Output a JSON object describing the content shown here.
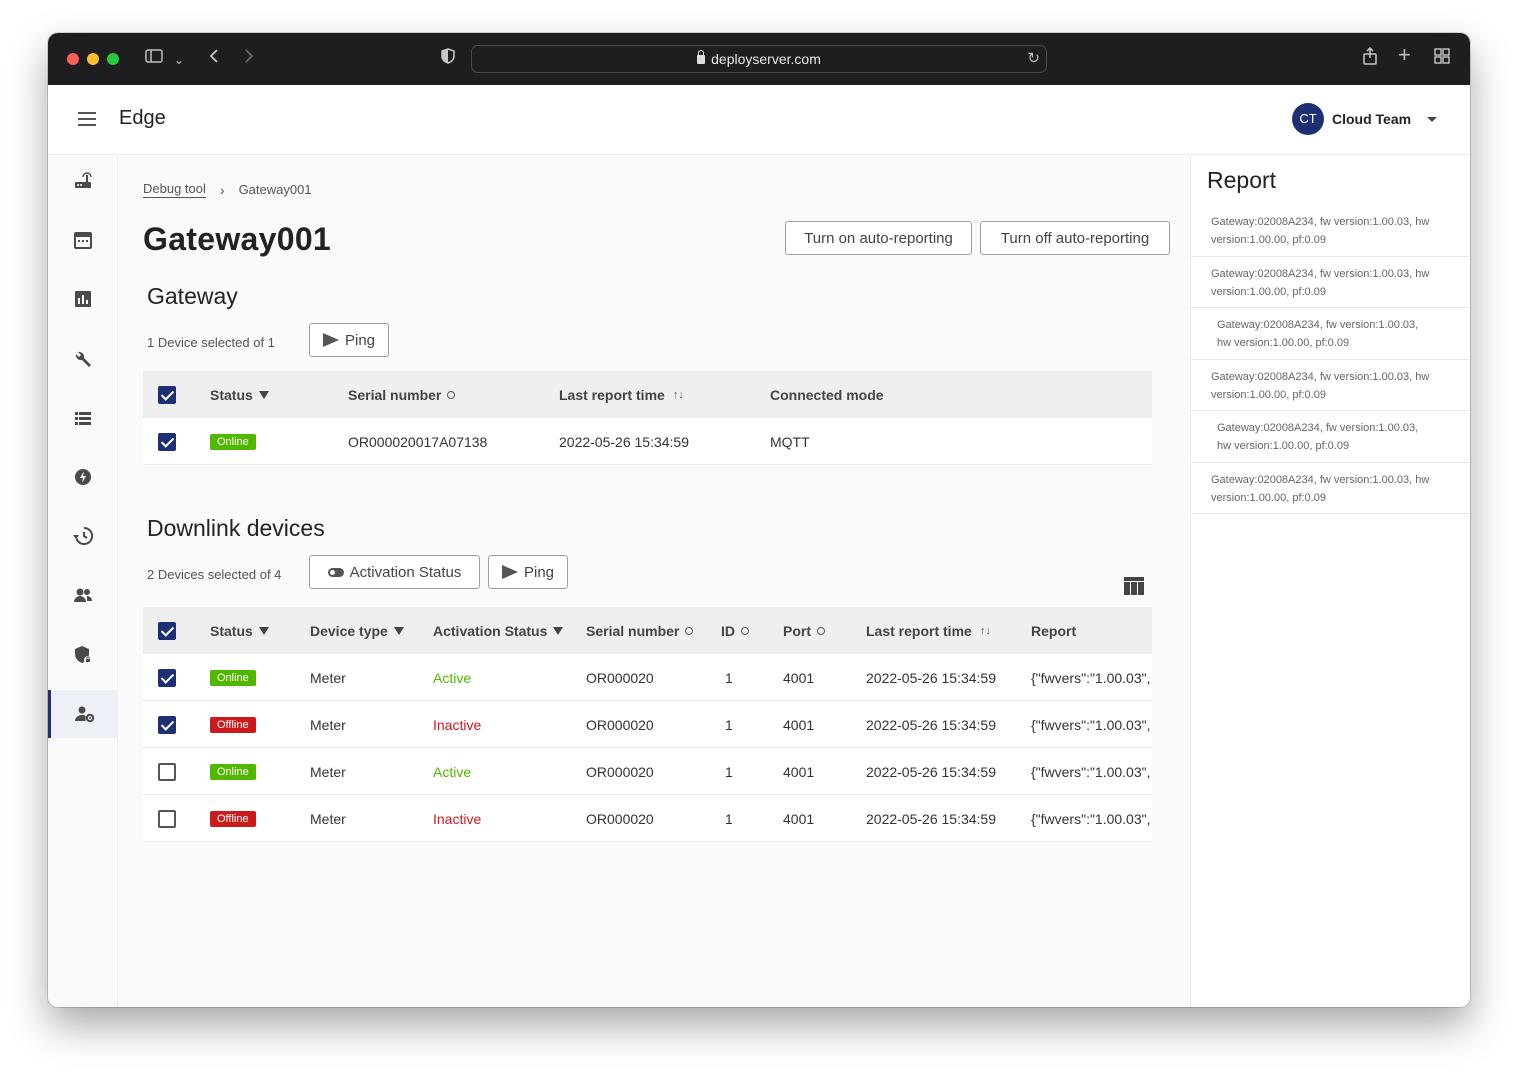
{
  "browser": {
    "url": "deployserver.com"
  },
  "app": {
    "title": "Edge",
    "user": {
      "initials": "CT",
      "name": "Cloud Team"
    }
  },
  "nav": {
    "items": [
      "router-icon",
      "calendar-icon",
      "bar-chart-icon",
      "wrench-icon",
      "list-icon",
      "eco-icon",
      "history-icon",
      "group-icon",
      "shield-lock-icon",
      "user-settings-icon"
    ],
    "active": "user-settings-icon"
  },
  "breadcrumb": {
    "link": "Debug tool",
    "current": "Gateway001"
  },
  "page": {
    "title": "Gateway001",
    "btn_auto_on": "Turn on auto-reporting",
    "btn_auto_off": "Turn off auto-reporting"
  },
  "gateway": {
    "title": "Gateway",
    "selection": "1 Device selected of 1",
    "ping_label": "Ping",
    "headers": {
      "status": "Status",
      "serial": "Serial number",
      "last_report": "Last report time",
      "mode": "Connected mode"
    },
    "rows": [
      {
        "checked": true,
        "status": "Online",
        "serial": "OR000020017A07138",
        "last_report": "2022-05-26 15:34:59",
        "mode": "MQTT"
      }
    ]
  },
  "downlink": {
    "title": "Downlink devices",
    "selection": "2 Devices selected of 4",
    "activation_label": "Activation Status",
    "ping_label": "Ping",
    "headers": {
      "status": "Status",
      "device_type": "Device type",
      "activation": "Activation Status",
      "serial": "Serial number",
      "id": "ID",
      "port": "Port",
      "last_report": "Last report time",
      "report": "Report"
    },
    "rows": [
      {
        "checked": true,
        "status": "Online",
        "device_type": "Meter",
        "activation": "Active",
        "serial": "OR000020",
        "id": "1",
        "port": "4001",
        "last_report": "2022-05-26 15:34:59",
        "report": "{\"fwvers\":\"1.00.03\","
      },
      {
        "checked": true,
        "status": "Offline",
        "device_type": "Meter",
        "activation": "Inactive",
        "serial": "OR000020",
        "id": "1",
        "port": "4001",
        "last_report": "2022-05-26 15:34:59",
        "report": "{\"fwvers\":\"1.00.03\","
      },
      {
        "checked": false,
        "status": "Online",
        "device_type": "Meter",
        "activation": "Active",
        "serial": "OR000020",
        "id": "1",
        "port": "4001",
        "last_report": "2022-05-26 15:34:59",
        "report": "{\"fwvers\":\"1.00.03\","
      },
      {
        "checked": false,
        "status": "Offline",
        "device_type": "Meter",
        "activation": "Inactive",
        "serial": "OR000020",
        "id": "1",
        "port": "4001",
        "last_report": "2022-05-26 15:34:59",
        "report": "{\"fwvers\":\"1.00.03\","
      }
    ]
  },
  "report_panel": {
    "title": "Report",
    "items": [
      {
        "line1": "Gateway:02008A234, fw version:1.00.03, hw",
        "line2": "version:1.00.00, pf:0.09"
      },
      {
        "line1": "Gateway:02008A234, fw version:1.00.03, hw",
        "line2": "version:1.00.00, pf:0.09"
      },
      {
        "line1": "Gateway:02008A234, fw version:1.00.03,",
        "line2": "hw version:1.00.00, pf:0.09"
      },
      {
        "line1": "Gateway:02008A234, fw version:1.00.03, hw",
        "line2": "version:1.00.00, pf:0.09"
      },
      {
        "line1": "Gateway:02008A234, fw version:1.00.03,",
        "line2": "hw version:1.00.00, pf:0.09"
      },
      {
        "line1": "Gateway:02008A234, fw version:1.00.03, hw",
        "line2": "version:1.00.00, pf:0.09"
      }
    ]
  },
  "colors": {
    "primary": "#1f2f73",
    "online": "#52b700",
    "offline": "#cc1a1a",
    "active_text": "#52b700",
    "inactive_text": "#d0171f"
  }
}
